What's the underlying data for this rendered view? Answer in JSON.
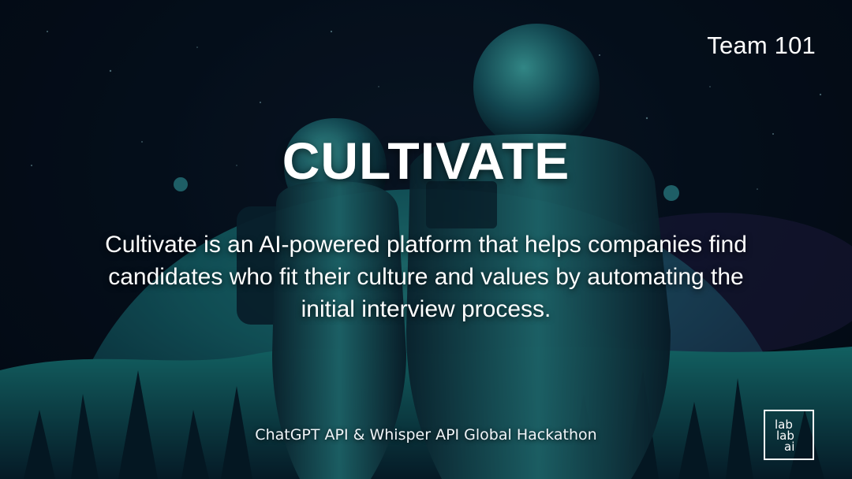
{
  "header": {
    "team_label": "Team 101"
  },
  "main": {
    "title": "CULTIVATE",
    "description": "Cultivate is an AI-powered platform that helps companies find candidates who fit their culture and values by automating the initial interview process."
  },
  "footer": {
    "event_label": "ChatGPT API & Whisper API Global Hackathon",
    "logo_lines": [
      "lab",
      "lab",
      "ai"
    ]
  },
  "colors": {
    "background": "#040c16",
    "accent_teal": "#2ec4b6",
    "text": "#ffffff"
  }
}
